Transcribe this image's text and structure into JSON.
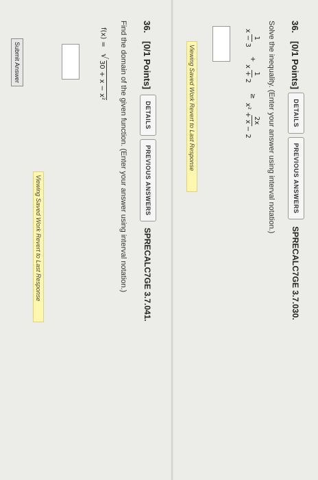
{
  "q1": {
    "number": "36.",
    "points": "[0/1 Points]",
    "details_label": "DETAILS",
    "previous_label": "PREVIOUS ANSWERS",
    "code": "SPRECALC7GE 3.7.030.",
    "prompt": "Solve the inequality. (Enter your answer using interval notation.)",
    "inequality": {
      "frac1_num": "1",
      "frac1_den": "x − 3",
      "plus": "+",
      "frac2_num": "1",
      "frac2_den": "x + 2",
      "relation": "≥",
      "frac3_num": "2x",
      "frac3_den": "x² + x − 2"
    },
    "notice": "Viewing Saved Work Revert to Last Response"
  },
  "q2": {
    "number": "36.",
    "points": "[0/1 Points]",
    "details_label": "DETAILS",
    "previous_label": "PREVIOUS ANSWERS",
    "code": "SPRECALC7GE 3.7.041.",
    "prompt": "Find the domain of the given function. (Enter your answer using interval notation.)",
    "function_lhs": "f(x) =",
    "radicand": "30 + x − x²",
    "notice": "Viewing Saved Work Revert to Last Response",
    "submit_label": "Submit Answer"
  }
}
